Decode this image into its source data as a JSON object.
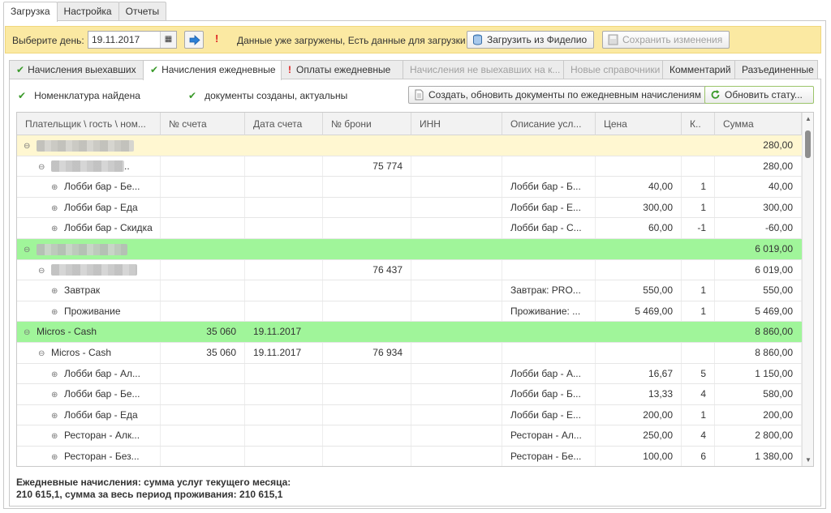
{
  "top_tabs": [
    {
      "label": "Загрузка",
      "active": true
    },
    {
      "label": "Настройка",
      "active": false
    },
    {
      "label": "Отчеты",
      "active": false
    }
  ],
  "toolbar": {
    "day_label": "Выберите день:",
    "date_value": "19.11.2017",
    "warning": "Данные уже загружены,  Есть данные для загрузки",
    "load_button": "Загрузить из Фиделио",
    "save_button": "Сохранить изменения"
  },
  "sub_tabs": [
    {
      "label": "Начисления выехавших",
      "icon": "check",
      "active": false,
      "disabled": false
    },
    {
      "label": "Начисления ежедневные",
      "icon": "check",
      "active": true,
      "disabled": false
    },
    {
      "label": "Оплаты ежедневные",
      "icon": "warning",
      "active": false,
      "disabled": false
    },
    {
      "label": "Начисления не выехавших на к...",
      "icon": "",
      "active": false,
      "disabled": true
    },
    {
      "label": "Новые справочники",
      "icon": "",
      "active": false,
      "disabled": true
    },
    {
      "label": "Комментарий",
      "icon": "",
      "active": false,
      "disabled": false
    },
    {
      "label": "Разъединенные",
      "icon": "",
      "active": false,
      "disabled": false
    }
  ],
  "status": {
    "nomenclature": "Номенклатура найдена",
    "documents": "документы созданы, актуальны",
    "create_button": "Создать, обновить документы по ежедневным начислениям",
    "refresh_button": "Обновить стату..."
  },
  "grid": {
    "columns": [
      "Плательщик \\ гость \\ ном...",
      "№ счета",
      "Дата счета",
      "№ брони",
      "ИНН",
      "Описание усл...",
      "Цена",
      "К..",
      "Сумма"
    ],
    "rows": [
      {
        "level": 0,
        "style": "yellow",
        "toggle": "minus",
        "name": "",
        "blur": 120,
        "account": "",
        "date": "",
        "booking": "",
        "inn": "",
        "desc": "",
        "price": "",
        "qty": "",
        "sum": "280,00"
      },
      {
        "level": 1,
        "style": "",
        "toggle": "minus",
        "name": "..",
        "blur": 90,
        "account": "",
        "date": "",
        "booking": "75 774",
        "inn": "",
        "desc": "",
        "price": "",
        "qty": "",
        "sum": "280,00"
      },
      {
        "level": 2,
        "style": "",
        "toggle": "plus",
        "name": "Лобби бар - Бе...",
        "blur": 0,
        "account": "",
        "date": "",
        "booking": "",
        "inn": "",
        "desc": "Лобби бар - Б...",
        "price": "40,00",
        "qty": "1",
        "sum": "40,00"
      },
      {
        "level": 2,
        "style": "",
        "toggle": "plus",
        "name": "Лобби бар - Еда",
        "blur": 0,
        "account": "",
        "date": "",
        "booking": "",
        "inn": "",
        "desc": "Лобби бар - Е...",
        "price": "300,00",
        "qty": "1",
        "sum": "300,00"
      },
      {
        "level": 2,
        "style": "",
        "toggle": "plus",
        "name": "Лобби бар - Скидка",
        "blur": 0,
        "account": "",
        "date": "",
        "booking": "",
        "inn": "",
        "desc": "Лобби бар - С...",
        "price": "60,00",
        "qty": "-1",
        "sum": "-60,00"
      },
      {
        "level": 0,
        "style": "green",
        "toggle": "minus",
        "name": "",
        "blur": 112,
        "account": "",
        "date": "",
        "booking": "",
        "inn": "",
        "desc": "",
        "price": "",
        "qty": "",
        "sum": "6 019,00"
      },
      {
        "level": 1,
        "style": "",
        "toggle": "minus",
        "name": "",
        "blur": 106,
        "account": "",
        "date": "",
        "booking": "76 437",
        "inn": "",
        "desc": "",
        "price": "",
        "qty": "",
        "sum": "6 019,00"
      },
      {
        "level": 2,
        "style": "",
        "toggle": "plus",
        "name": "Завтрак",
        "blur": 0,
        "account": "",
        "date": "",
        "booking": "",
        "inn": "",
        "desc": "Завтрак: PRO...",
        "price": "550,00",
        "qty": "1",
        "sum": "550,00"
      },
      {
        "level": 2,
        "style": "",
        "toggle": "plus",
        "name": "Проживание",
        "blur": 0,
        "account": "",
        "date": "",
        "booking": "",
        "inn": "",
        "desc": "Проживание: ...",
        "price": "5 469,00",
        "qty": "1",
        "sum": "5 469,00"
      },
      {
        "level": 0,
        "style": "green",
        "toggle": "minus",
        "name": "Micros - Cash",
        "blur": 0,
        "account": "35 060",
        "date": "19.11.2017",
        "booking": "",
        "inn": "",
        "desc": "",
        "price": "",
        "qty": "",
        "sum": "8 860,00"
      },
      {
        "level": 1,
        "style": "",
        "toggle": "minus",
        "name": "Micros - Cash",
        "blur": 0,
        "account": "35 060",
        "date": "19.11.2017",
        "booking": "76 934",
        "inn": "",
        "desc": "",
        "price": "",
        "qty": "",
        "sum": "8 860,00"
      },
      {
        "level": 2,
        "style": "",
        "toggle": "plus",
        "name": "Лобби бар - Ал...",
        "blur": 0,
        "account": "",
        "date": "",
        "booking": "",
        "inn": "",
        "desc": "Лобби бар - А...",
        "price": "16,67",
        "qty": "5",
        "sum": "1 150,00"
      },
      {
        "level": 2,
        "style": "",
        "toggle": "plus",
        "name": "Лобби бар - Бе...",
        "blur": 0,
        "account": "",
        "date": "",
        "booking": "",
        "inn": "",
        "desc": "Лобби бар - Б...",
        "price": "13,33",
        "qty": "4",
        "sum": "580,00"
      },
      {
        "level": 2,
        "style": "",
        "toggle": "plus",
        "name": "Лобби бар - Еда",
        "blur": 0,
        "account": "",
        "date": "",
        "booking": "",
        "inn": "",
        "desc": "Лобби бар - Е...",
        "price": "200,00",
        "qty": "1",
        "sum": "200,00"
      },
      {
        "level": 2,
        "style": "",
        "toggle": "plus",
        "name": "Ресторан - Алк...",
        "blur": 0,
        "account": "",
        "date": "",
        "booking": "",
        "inn": "",
        "desc": "Ресторан - Ал...",
        "price": "250,00",
        "qty": "4",
        "sum": "2 800,00"
      },
      {
        "level": 2,
        "style": "",
        "toggle": "plus",
        "name": "Ресторан - Без...",
        "blur": 0,
        "account": "",
        "date": "",
        "booking": "",
        "inn": "",
        "desc": "Ресторан - Бе...",
        "price": "100,00",
        "qty": "6",
        "sum": "1 380,00"
      }
    ]
  },
  "footer": {
    "line1": "Ежедневные начисления: сумма услуг текущего месяца:",
    "line2": "210 615,1, сумма за весь период проживания: 210 615,1"
  },
  "colors": {
    "toolbar_bg": "#fbe9a2",
    "row_yellow": "#fff7d1",
    "row_green": "#a0f59a",
    "check": "#3a9a2a",
    "warning": "#dd2222"
  }
}
